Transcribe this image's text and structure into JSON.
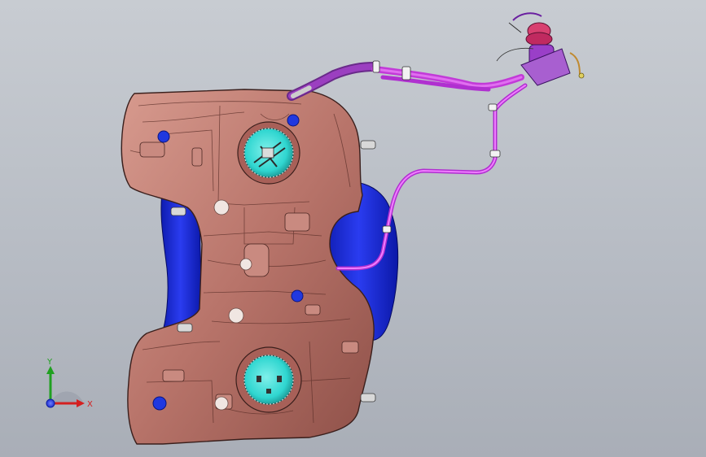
{
  "viewport": {
    "background_top": "#c8ccd2",
    "background_bottom": "#a9aeb7"
  },
  "model": {
    "tank_color": "#b8746a",
    "tank_edge_color": "#3a1f1c",
    "shield_color": "#1a2bd6",
    "hose_color": "#c23ad8",
    "cap_color": "#2fd6d0",
    "plug_color": "#2038e0"
  },
  "triad": {
    "x_label": "X",
    "y_label": "Y",
    "x_color": "#d42020",
    "y_color": "#20a020",
    "z_color": "#2030d0",
    "icon": "coordinate-triad-icon"
  }
}
